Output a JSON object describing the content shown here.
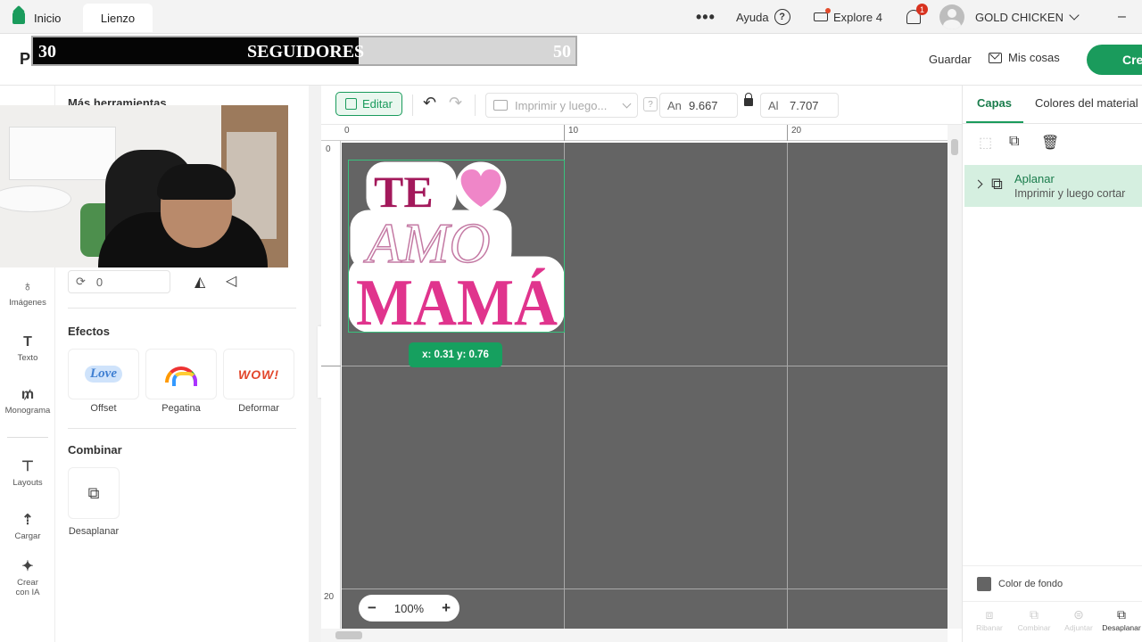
{
  "topbar": {
    "tabs": [
      {
        "label": "Inicio",
        "icon": "home-icon"
      },
      {
        "label": "Lienzo"
      }
    ],
    "more_label": "•••",
    "help_label": "Ayuda",
    "machine_label": "Explore 4",
    "notification_count": "1",
    "user_name": "GOLD CHICKEN",
    "minimize_label": "–"
  },
  "header": {
    "project_title": "Pr",
    "save_label": "Guardar",
    "my_stuff_label": "Mis cosas",
    "create_label": "Cre"
  },
  "follower_goal": {
    "start": "30",
    "label": "SEGUIDORES",
    "end": "50",
    "fill_fraction": 0.6
  },
  "left_nav": [
    {
      "label": "Imágenes",
      "icon": "balloon-icon",
      "glyph": "♁"
    },
    {
      "label": "Texto",
      "icon": "text-icon",
      "glyph": "T"
    },
    {
      "label": "Monograma",
      "icon": "monogram-icon",
      "glyph": "₥"
    },
    {
      "label": "Layouts",
      "icon": "shirt-icon",
      "glyph": "⊤"
    },
    {
      "label": "Cargar",
      "icon": "upload-icon",
      "glyph": "⇡"
    },
    {
      "label": "Crear con IA",
      "icon": "sparkle-icon",
      "glyph": "✦"
    }
  ],
  "tool_panel": {
    "title": "Más herramientas",
    "rotate_value": "0",
    "effects_title": "Efectos",
    "effects": [
      {
        "label": "Offset",
        "preview": "Love"
      },
      {
        "label": "Pegatina"
      },
      {
        "label": "Deformar",
        "preview": "WOW!"
      }
    ],
    "combine_title": "Combinar",
    "flatten_action_label": "Desaplanar"
  },
  "canvas_toolbar": {
    "edit_label": "Editar",
    "print_placeholder": "Imprimir y luego...",
    "info_label": "?",
    "width_label": "An",
    "width_value": "9.667",
    "height_label": "Al",
    "height_value": "7.707"
  },
  "ruler": {
    "top_ticks": [
      "0",
      "10",
      "20"
    ],
    "left_ticks": [
      "0",
      "20"
    ]
  },
  "design": {
    "line1": "TE",
    "line2": "AMO",
    "line3": "MAMÁ",
    "colors": {
      "dark_pink": "#a3195b",
      "pink": "#e0348d",
      "heart": "#ef86c8",
      "mauve": "#c47aa4"
    }
  },
  "canvas": {
    "coord_readout": "x: 0.31 y: 0.76",
    "zoom_label": "100%",
    "zoom_minus": "−",
    "zoom_plus": "+",
    "background_color": "#646464"
  },
  "right_panel": {
    "tabs": [
      "Capas",
      "Colores del material"
    ],
    "layer": {
      "name": "Aplanar",
      "subtitle": "Imprimir y luego cortar"
    },
    "bg_color_label": "Color de fondo",
    "bottom_actions": [
      "Ribanar",
      "Combinar",
      "Adjuntar",
      "Desaplanar"
    ]
  },
  "accent_color": "#1a9b5c"
}
